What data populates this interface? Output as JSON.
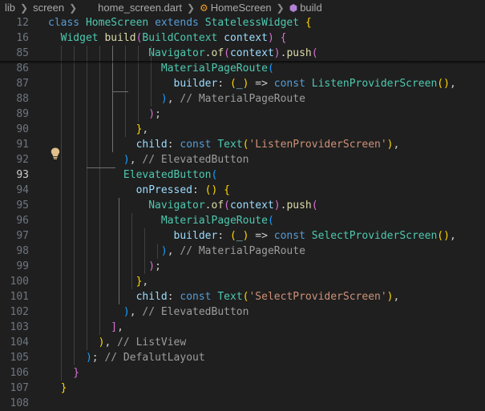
{
  "breadcrumb": {
    "folder1": "lib",
    "folder2": "screen",
    "file": "home_screen.dart",
    "class": "HomeScreen",
    "method": "build"
  },
  "lines": [
    {
      "n": "12",
      "tokens": [
        [
          "kw",
          "class "
        ],
        [
          "cls",
          "HomeScreen "
        ],
        [
          "kw",
          "extends "
        ],
        [
          "cls",
          "StatelessWidget "
        ],
        [
          "b1",
          "{"
        ]
      ]
    },
    {
      "n": "16",
      "tokens": [
        [
          "cls",
          "  Widget "
        ],
        [
          "fn",
          "build"
        ],
        [
          "b2",
          "("
        ],
        [
          "cls",
          "BuildContext "
        ],
        [
          "prop",
          "context"
        ],
        [
          "b2",
          ")"
        ],
        [
          "p",
          " "
        ],
        [
          "b2",
          "{"
        ]
      ]
    },
    {
      "n": "85",
      "tokens": [
        [
          "cls",
          "                Navigator"
        ],
        [
          "p",
          "."
        ],
        [
          "fn",
          "of"
        ],
        [
          "b2",
          "("
        ],
        [
          "prop",
          "context"
        ],
        [
          "b2",
          ")"
        ],
        [
          "p",
          "."
        ],
        [
          "fn",
          "push"
        ],
        [
          "b2",
          "("
        ]
      ]
    },
    {
      "n": "86",
      "tokens": [
        [
          "cls",
          "                  MaterialPageRoute"
        ],
        [
          "b3",
          "("
        ]
      ]
    },
    {
      "n": "87",
      "tokens": [
        [
          "prop",
          "                    builder"
        ],
        [
          "p",
          ": "
        ],
        [
          "b1",
          "("
        ],
        [
          "prop",
          "_"
        ],
        [
          "b1",
          ")"
        ],
        [
          "p",
          " => "
        ],
        [
          "kw",
          "const "
        ],
        [
          "cls",
          "ListenProviderScreen"
        ],
        [
          "b1",
          "()"
        ],
        [
          "p",
          ","
        ]
      ]
    },
    {
      "n": "88",
      "tokens": [
        [
          "b3",
          "                  )"
        ],
        [
          "p",
          ", "
        ],
        [
          "cmt",
          "// MaterialPageRoute"
        ]
      ]
    },
    {
      "n": "89",
      "tokens": [
        [
          "b2",
          "                )"
        ],
        [
          "p",
          ";"
        ]
      ]
    },
    {
      "n": "90",
      "tokens": [
        [
          "b1",
          "              }"
        ],
        [
          "p",
          ","
        ]
      ]
    },
    {
      "n": "91",
      "tokens": [
        [
          "prop",
          "              child"
        ],
        [
          "p",
          ": "
        ],
        [
          "kw",
          "const "
        ],
        [
          "cls",
          "Text"
        ],
        [
          "b1",
          "("
        ],
        [
          "str",
          "'ListenProviderScreen'"
        ],
        [
          "b1",
          ")"
        ],
        [
          "p",
          ","
        ]
      ]
    },
    {
      "n": "92",
      "tokens": [
        [
          "b3",
          "            )"
        ],
        [
          "p",
          ", "
        ],
        [
          "cmt",
          "// ElevatedButton"
        ]
      ]
    },
    {
      "n": "93",
      "tokens": [
        [
          "cls",
          "            ElevatedButton"
        ],
        [
          "b3",
          "("
        ]
      ]
    },
    {
      "n": "94",
      "tokens": [
        [
          "prop",
          "              onPressed"
        ],
        [
          "p",
          ": "
        ],
        [
          "b1",
          "()"
        ],
        [
          "p",
          " "
        ],
        [
          "b1",
          "{"
        ]
      ]
    },
    {
      "n": "95",
      "tokens": [
        [
          "cls",
          "                Navigator"
        ],
        [
          "p",
          "."
        ],
        [
          "fn",
          "of"
        ],
        [
          "b2",
          "("
        ],
        [
          "prop",
          "context"
        ],
        [
          "b2",
          ")"
        ],
        [
          "p",
          "."
        ],
        [
          "fn",
          "push"
        ],
        [
          "b2",
          "("
        ]
      ]
    },
    {
      "n": "96",
      "tokens": [
        [
          "cls",
          "                  MaterialPageRoute"
        ],
        [
          "b3",
          "("
        ]
      ]
    },
    {
      "n": "97",
      "tokens": [
        [
          "prop",
          "                    builder"
        ],
        [
          "p",
          ": "
        ],
        [
          "b1",
          "("
        ],
        [
          "prop",
          "_"
        ],
        [
          "b1",
          ")"
        ],
        [
          "p",
          " => "
        ],
        [
          "kw",
          "const "
        ],
        [
          "cls",
          "SelectProviderScreen"
        ],
        [
          "b1",
          "()"
        ],
        [
          "p",
          ","
        ]
      ]
    },
    {
      "n": "98",
      "tokens": [
        [
          "b3",
          "                  )"
        ],
        [
          "p",
          ", "
        ],
        [
          "cmt",
          "// MaterialPageRoute"
        ]
      ]
    },
    {
      "n": "99",
      "tokens": [
        [
          "b2",
          "                )"
        ],
        [
          "p",
          ";"
        ]
      ]
    },
    {
      "n": "100",
      "tokens": [
        [
          "b1",
          "              }"
        ],
        [
          "p",
          ","
        ]
      ]
    },
    {
      "n": "101",
      "tokens": [
        [
          "prop",
          "              child"
        ],
        [
          "p",
          ": "
        ],
        [
          "kw",
          "const "
        ],
        [
          "cls",
          "Text"
        ],
        [
          "b1",
          "("
        ],
        [
          "str",
          "'SelectProviderScreen'"
        ],
        [
          "b1",
          ")"
        ],
        [
          "p",
          ","
        ]
      ]
    },
    {
      "n": "102",
      "tokens": [
        [
          "b3",
          "            )"
        ],
        [
          "p",
          ", "
        ],
        [
          "cmt",
          "// ElevatedButton"
        ]
      ]
    },
    {
      "n": "103",
      "tokens": [
        [
          "b2",
          "          ]"
        ],
        [
          "p",
          ","
        ]
      ]
    },
    {
      "n": "104",
      "tokens": [
        [
          "b1",
          "        )"
        ],
        [
          "p",
          ", "
        ],
        [
          "cmt",
          "// ListView"
        ]
      ]
    },
    {
      "n": "105",
      "tokens": [
        [
          "b3",
          "      )"
        ],
        [
          "p",
          "; "
        ],
        [
          "cmt",
          "// DefalutLayout"
        ]
      ]
    },
    {
      "n": "106",
      "tokens": [
        [
          "b2",
          "    }"
        ]
      ]
    },
    {
      "n": "107",
      "tokens": [
        [
          "b1",
          "  }"
        ]
      ]
    },
    {
      "n": "108",
      "tokens": []
    }
  ],
  "active_line": "93",
  "colors": {
    "background": "#1f1f1f",
    "keyword": "#569cd6",
    "class": "#4ec9b0",
    "function": "#dcdcaa",
    "property": "#9cdcfe",
    "string": "#ce9178",
    "comment": "#6a9955"
  },
  "icons": {
    "chevron": "chevron-right-icon",
    "class": "class-symbol-icon",
    "method": "method-symbol-icon",
    "lightbulb": "lightbulb-icon"
  }
}
